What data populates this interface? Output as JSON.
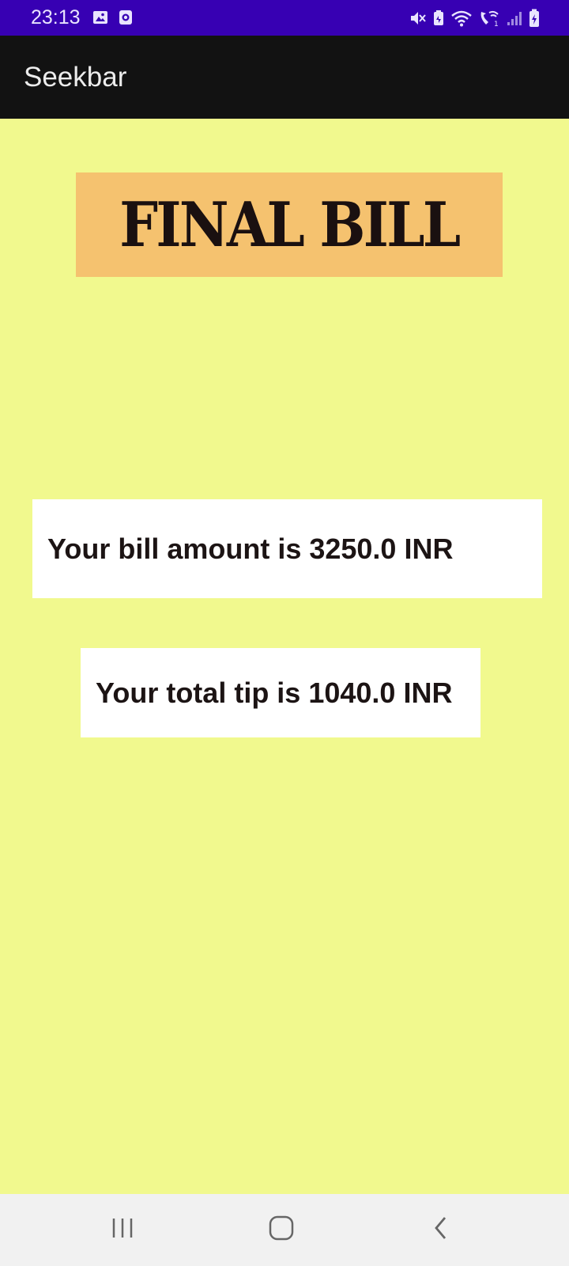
{
  "status_bar": {
    "time": "23:13",
    "left_icons": [
      "gallery-icon",
      "screen-recorder-icon"
    ],
    "right_icons": [
      "mute-icon",
      "battery-saver-icon",
      "wifi-icon",
      "wifi-calling-icon",
      "signal-icon",
      "battery-charging-icon"
    ]
  },
  "app_bar": {
    "title": "Seekbar"
  },
  "main": {
    "heading": "FINAL BILL",
    "bill_amount_text": "Your bill amount is 3250.0 INR",
    "total_tip_text": "Your total tip is 1040.0 INR"
  },
  "nav_bar": {
    "buttons": [
      "recents-icon",
      "home-icon",
      "back-icon"
    ]
  },
  "colors": {
    "status_bar": "#3700b3",
    "app_bar": "#121212",
    "background": "#f1f98e",
    "banner": "#f5c26f",
    "card": "#ffffff",
    "nav_bar": "#f1f1f1"
  }
}
